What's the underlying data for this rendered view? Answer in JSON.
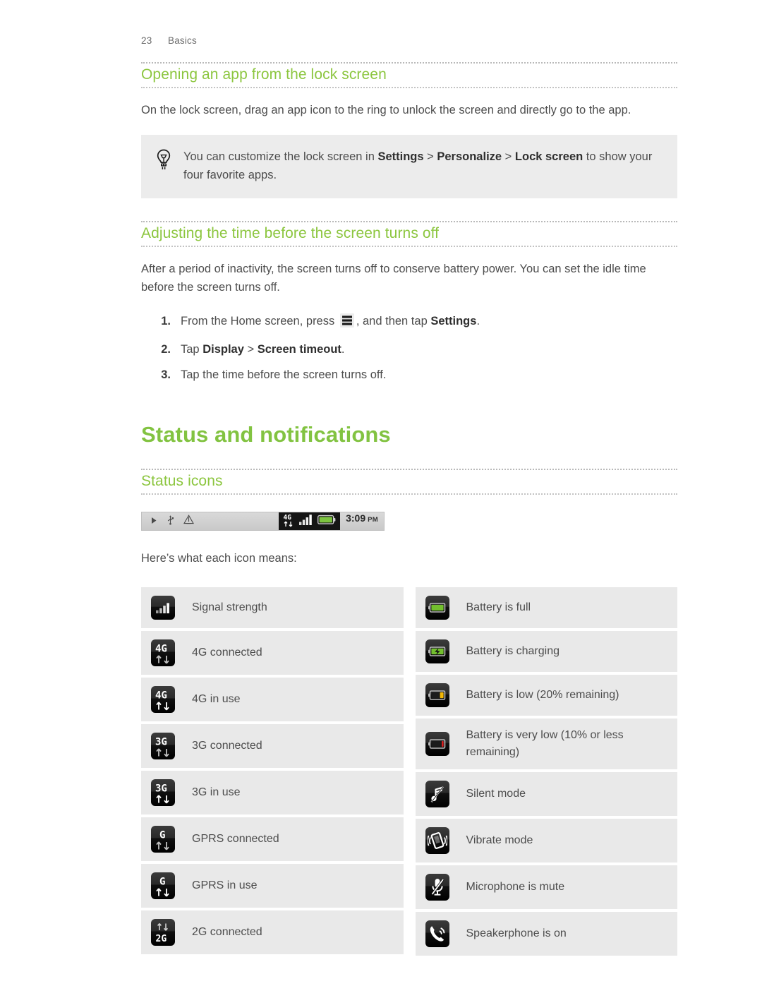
{
  "runhead": {
    "page": "23",
    "section": "Basics"
  },
  "sections": {
    "lockscreen": {
      "heading": "Opening an app from the lock screen",
      "body": "On the lock screen, drag an app icon to the ring to unlock the screen and directly go to the app.",
      "tip": {
        "icon": "lightbulb-icon",
        "text_before": "You can customize the lock screen in ",
        "bold1": "Settings",
        "sep1": " > ",
        "bold2": "Personalize",
        "sep2": " > ",
        "bold3": "Lock screen",
        "text_after": " to show your four favorite apps."
      }
    },
    "screen_timeout": {
      "heading": "Adjusting the time before the screen turns off",
      "body": "After a period of inactivity, the screen turns off to conserve battery power. You can set the idle time before the screen turns off.",
      "steps": [
        {
          "num": "1.",
          "text_before": "From the Home screen, press ",
          "icon": "menu-icon",
          "text_mid": ", and then tap ",
          "bold": "Settings",
          "text_after": "."
        },
        {
          "num": "2.",
          "text_before": "Tap ",
          "bold": "Display",
          "sep": " > ",
          "bold2": "Screen timeout",
          "text_after": "."
        },
        {
          "num": "3.",
          "text_before": "Tap the time before the screen turns off.",
          "bold": "",
          "text_after": ""
        }
      ]
    },
    "status": {
      "title": "Status and notifications",
      "heading": "Status icons",
      "statusbar": {
        "left_icons": [
          "play-icon",
          "usb-icon",
          "alert-icon"
        ],
        "dark_icons": [
          "4g-in-use-icon",
          "signal-strength-icon",
          "battery-full-icon"
        ],
        "time": "3:09",
        "ampm": "PM"
      },
      "intro": "Here’s what each icon means:",
      "left_column": [
        {
          "icon": "signal-strength-icon",
          "label": "Signal strength"
        },
        {
          "icon": "4g-connected-icon",
          "label": "4G connected"
        },
        {
          "icon": "4g-in-use-icon",
          "label": "4G in use"
        },
        {
          "icon": "3g-connected-icon",
          "label": "3G connected"
        },
        {
          "icon": "3g-in-use-icon",
          "label": "3G in use"
        },
        {
          "icon": "gprs-connected-icon",
          "label": "GPRS connected"
        },
        {
          "icon": "gprs-in-use-icon",
          "label": "GPRS in use"
        },
        {
          "icon": "2g-connected-icon",
          "label": "2G connected"
        }
      ],
      "right_column": [
        {
          "icon": "battery-full-icon",
          "label": "Battery is full"
        },
        {
          "icon": "battery-charging-icon",
          "label": "Battery is charging"
        },
        {
          "icon": "battery-low-icon",
          "label": "Battery is low (20% remaining)"
        },
        {
          "icon": "battery-very-low-icon",
          "label": "Battery is very low (10% or less remaining)"
        },
        {
          "icon": "silent-mode-icon",
          "label": "Silent mode"
        },
        {
          "icon": "vibrate-mode-icon",
          "label": "Vibrate mode"
        },
        {
          "icon": "microphone-mute-icon",
          "label": "Microphone is mute"
        },
        {
          "icon": "speakerphone-icon",
          "label": "Speakerphone is on"
        }
      ]
    }
  },
  "colors": {
    "heading_green": "#8cc63f",
    "title_green": "#82c341",
    "cell_bg": "#e9e9e9",
    "tip_bg": "#ececec",
    "battery_green": "#73bf2e",
    "battery_amber": "#f2b705",
    "battery_red": "#e02020"
  }
}
